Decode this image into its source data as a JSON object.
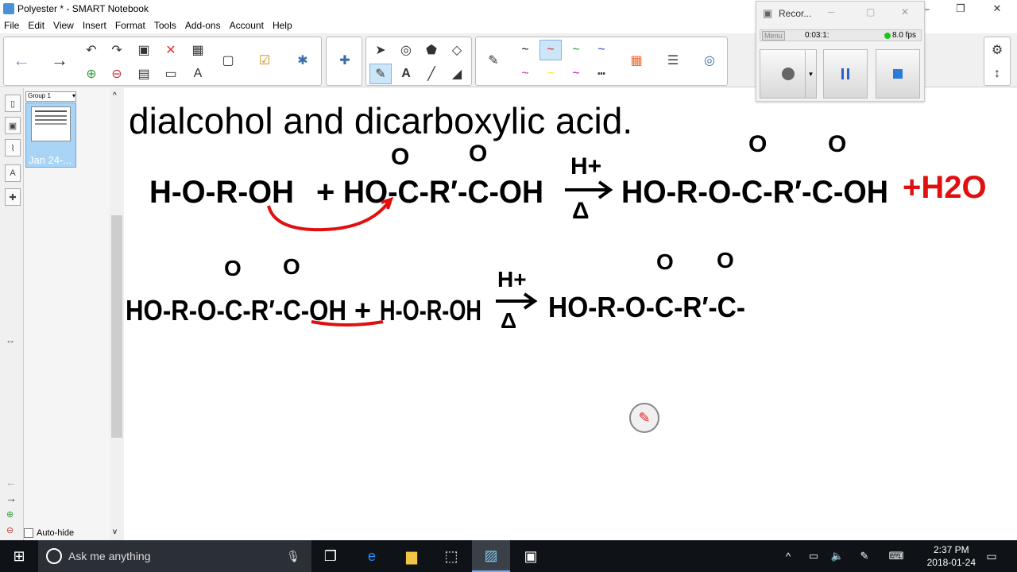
{
  "window": {
    "title": "Polyester * - SMART Notebook",
    "minimize": "─",
    "restore": "❐",
    "close": "✕"
  },
  "menu": [
    "File",
    "Edit",
    "View",
    "Insert",
    "Format",
    "Tools",
    "Add-ons",
    "Account",
    "Help"
  ],
  "pages": {
    "group_label": "Group 1",
    "thumb_caption": "Jan 24-...",
    "autohide_label": "Auto-hide"
  },
  "canvas": {
    "heading": "dialcohol and dicarboxylic acid.",
    "ink_color": "#000000",
    "accent_color": "#e01010",
    "line1": {
      "reactant1": "H-O-R-OH",
      "plus": "+",
      "reactant2": "HO-C-R′-C-OH",
      "catalyst": "H+",
      "heat": "Δ",
      "product": "HO-R-O-C-R′-C-OH",
      "byproduct": "+H2O"
    },
    "line2": {
      "reactant1": "HO-R-O-C-R′-C-OH",
      "plus": "+",
      "reactant2": "H-O-R-OH",
      "catalyst": "H+",
      "heat": "Δ",
      "product": "HO-R-O-C-R′-C-"
    },
    "carbonyl_O": "O"
  },
  "recorder": {
    "title": "Recor...",
    "menu": "Menu",
    "time": "0:03:1:",
    "fps": "8.0 fps"
  },
  "taskbar": {
    "search_placeholder": "Ask me anything",
    "time": "2:37 PM",
    "date": "2018-01-24"
  }
}
